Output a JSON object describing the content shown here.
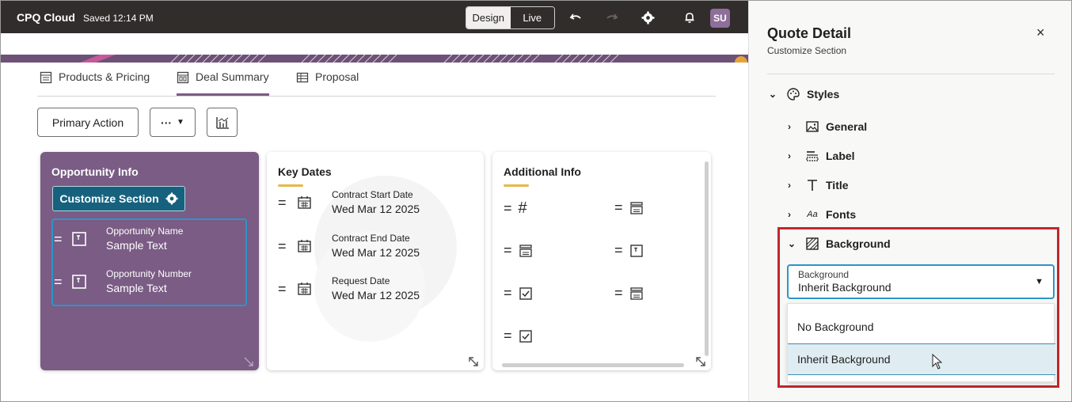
{
  "app": {
    "title": "CPQ Cloud",
    "saved_status": "Saved 12:14 PM"
  },
  "mode_toggle": {
    "design": "Design",
    "live": "Live",
    "selected": "Live"
  },
  "toolbar_icons": [
    "undo-icon",
    "redo-icon",
    "settings-icon",
    "notifications-icon"
  ],
  "user": {
    "initials": "SU"
  },
  "tabs": [
    {
      "label": "Products & Pricing",
      "icon": "table-icon"
    },
    {
      "label": "Deal Summary",
      "icon": "dashboard-icon",
      "active": true
    },
    {
      "label": "Proposal",
      "icon": "grid-icon"
    }
  ],
  "actions": {
    "primary": "Primary Action",
    "more": "···",
    "chart_icon": "chart-icon"
  },
  "cards": {
    "opportunity": {
      "title": "Opportunity Info",
      "customize_button": "Customize Section",
      "fields": [
        {
          "label": "Opportunity Name",
          "value": "Sample Text"
        },
        {
          "label": "Opportunity Number",
          "value": "Sample Text"
        }
      ]
    },
    "key_dates": {
      "title": "Key Dates",
      "fields": [
        {
          "label": "Contract Start Date",
          "value": "Wed Mar 12 2025"
        },
        {
          "label": "Contract End Date",
          "value": "Wed Mar 12 2025"
        },
        {
          "label": "Request Date",
          "value": "Wed Mar 12 2025"
        }
      ]
    },
    "additional": {
      "title": "Additional Info",
      "items": [
        "hash-icon",
        "form-icon",
        "form-icon",
        "text-field-icon",
        "checkbox-icon",
        "form-icon",
        "checkbox-icon"
      ]
    }
  },
  "panel": {
    "title": "Quote Detail",
    "subtitle": "Customize Section",
    "close": "×",
    "styles": "Styles",
    "sections": [
      "General",
      "Label",
      "Title",
      "Fonts",
      "Background"
    ],
    "fonts_icon_text": "Aa",
    "background_select": {
      "label": "Background",
      "value": "Inherit Background"
    },
    "options": [
      "No Background",
      "Inherit Background"
    ],
    "highlight_color": "#c0272d",
    "accent": "#2c95c9"
  },
  "colors": {
    "topbar": "#312d2a",
    "purple": "#7a5c85",
    "teal": "#16627e",
    "gold": "#e6b84a"
  }
}
